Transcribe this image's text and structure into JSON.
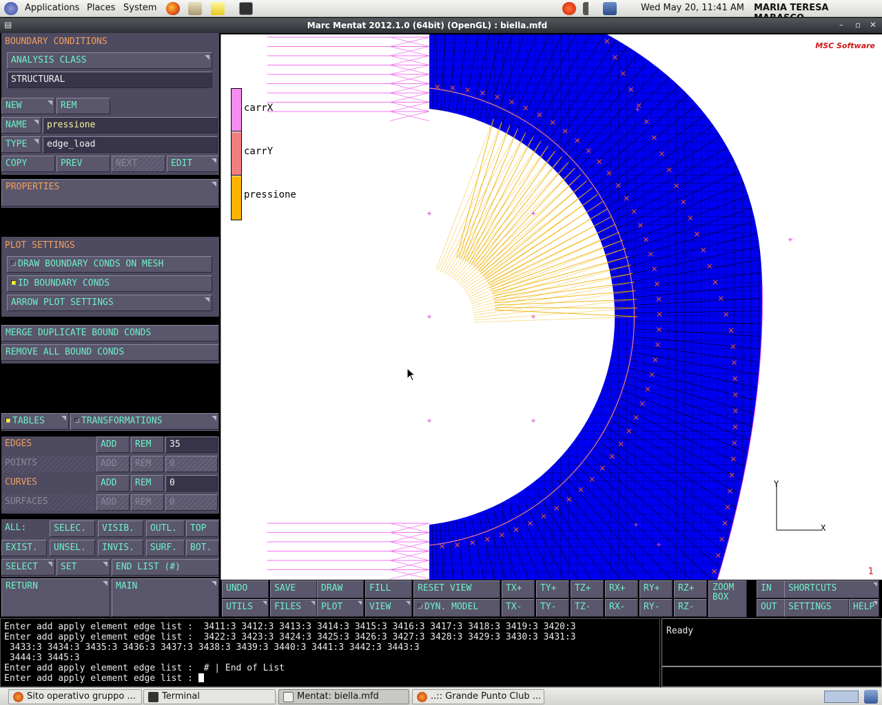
{
  "panel": {
    "applications": "Applications",
    "places": "Places",
    "system": "System",
    "datetime": "Wed May 20, 11:41 AM",
    "user": "MARIA TERESA MARASCO"
  },
  "window": {
    "title": "Marc Mentat 2012.1.0 (64bit) (OpenGL) : biella.mfd"
  },
  "menu": {
    "section_title": "BOUNDARY CONDITIONS",
    "analysis_class": "ANALYSIS CLASS",
    "analysis_value": "STRUCTURAL",
    "new": "NEW",
    "rem": "REM",
    "name_label": "NAME",
    "name_value": "pressione",
    "type_label": "TYPE",
    "type_value": "edge_load",
    "copy": "COPY",
    "prev": "PREV",
    "next": "NEXT",
    "edit": "EDIT",
    "properties": "PROPERTIES",
    "plot_settings": "PLOT SETTINGS",
    "draw_bc": "DRAW BOUNDARY CONDS ON MESH",
    "id_bc": "ID BOUNDARY CONDS",
    "arrow_plot": "ARROW PLOT SETTINGS",
    "merge_dup": "MERGE DUPLICATE BOUND CONDS",
    "remove_all": "REMOVE ALL BOUND CONDS",
    "tables": "TABLES",
    "transformations": "TRANSFORMATIONS",
    "entities": [
      {
        "label": "EDGES",
        "add": "ADD",
        "rem": "REM",
        "count": "35",
        "enabled": true
      },
      {
        "label": "POINTS",
        "add": "ADD",
        "rem": "REM",
        "count": "0",
        "enabled": false
      },
      {
        "label": "CURVES",
        "add": "ADD",
        "rem": "REM",
        "count": "0",
        "enabled": true
      },
      {
        "label": "SURFACES",
        "add": "ADD",
        "rem": "REM",
        "count": "0",
        "enabled": false
      }
    ],
    "all": "ALL:",
    "selec": "SELEC.",
    "visib": "VISIB.",
    "outl": "OUTL.",
    "top": "TOP",
    "exist": "EXIST.",
    "unsel": "UNSEL.",
    "invis": "INVIS.",
    "surf": "SURF.",
    "bot": "BOT.",
    "select": "SELECT",
    "set": "SET",
    "end_list": "END LIST (#)",
    "return": "RETURN",
    "main": "MAIN"
  },
  "viewport": {
    "logo": "MSC Software",
    "view_number": "1",
    "legend": [
      {
        "name": "carrX",
        "color": "#f58cf0"
      },
      {
        "name": "carrY",
        "color": "#f08080"
      },
      {
        "name": "pressione",
        "color": "#ffb400"
      }
    ],
    "axis_y": "Y",
    "axis_x": "X",
    "mesh_color": "#0000f0"
  },
  "toolbar": {
    "undo": "UNDO",
    "save": "SAVE",
    "draw": "DRAW",
    "fill": "FILL",
    "reset_view": "RESET VIEW",
    "tx_plus": "TX+",
    "ty_plus": "TY+",
    "tz_plus": "TZ+",
    "rx_plus": "RX+",
    "ry_plus": "RY+",
    "rz_plus": "RZ+",
    "zoom_box_1": "ZOOM",
    "zoom_box_2": "BOX",
    "in": "IN",
    "shortcuts": "SHORTCUTS",
    "utils": "UTILS",
    "files": "FILES",
    "plot": "PLOT",
    "view": "VIEW",
    "dyn_model": "DYN. MODEL",
    "tx_minus": "TX-",
    "ty_minus": "TY-",
    "tz_minus": "TZ-",
    "rx_minus": "RX-",
    "ry_minus": "RY-",
    "rz_minus": "RZ-",
    "out": "OUT",
    "settings": "SETTINGS",
    "help": "HELP"
  },
  "console": {
    "lines": [
      "Enter add apply element edge list :  3411:3 3412:3 3413:3 3414:3 3415:3 3416:3 3417:3 3418:3 3419:3 3420:3",
      "Enter add apply element edge list :  3422:3 3423:3 3424:3 3425:3 3426:3 3427:3 3428:3 3429:3 3430:3 3431:3",
      " 3433:3 3434:3 3435:3 3436:3 3437:3 3438:3 3439:3 3440:3 3441:3 3442:3 3443:3",
      " 3444:3 3445:3",
      "Enter add apply element edge list :  # | End of List"
    ],
    "prompt": "Enter add apply element edge list : ",
    "status": "Ready"
  },
  "taskbar": {
    "tasks": [
      {
        "label": "Sito operativo gruppo ...",
        "active": false
      },
      {
        "label": "Terminal",
        "active": false
      },
      {
        "label": "Mentat: biella.mfd",
        "active": true
      },
      {
        "label": "..:: Grande Punto Club ...",
        "active": false
      }
    ]
  }
}
